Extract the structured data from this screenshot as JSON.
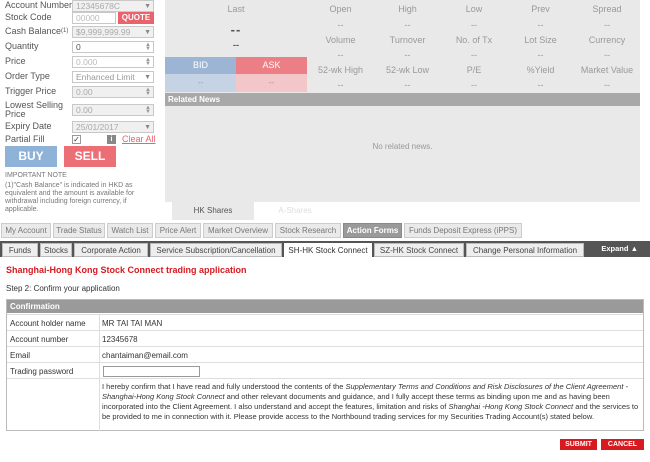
{
  "order_form": {
    "account_number_label": "Account Number",
    "account_number_value": "12345678C",
    "stock_code_label": "Stock Code",
    "stock_code_value": "00000",
    "quote_button": "QUOTE",
    "cash_balance_label": "Cash Balance",
    "cash_balance_sup": "(1)",
    "cash_balance_value": "$9,999,999.99",
    "quantity_label": "Quantity",
    "quantity_value": "0",
    "price_label": "Price",
    "price_value": "0.000",
    "order_type_label": "Order Type",
    "order_type_value": "Enhanced Limit",
    "trigger_price_label": "Trigger Price",
    "trigger_price_value": "0.00",
    "lowest_selling_label_1": "Lowest Selling",
    "lowest_selling_label_2": "Price",
    "lowest_selling_value": "0.00",
    "expiry_label": "Expiry Date",
    "expiry_value": "25/01/2017",
    "partial_fill_label": "Partial Fill",
    "partial_fill_check": "✓",
    "info_icon": "i",
    "clear_all": "Clear All",
    "buy": "BUY",
    "sell": "SELL",
    "important_note_title": "IMPORTANT NOTE",
    "important_note_text": "(1)\"Cash Balance\" is indicated in HKD as equivalent and the amount is available for withdrawal including foreign currency, if applicable."
  },
  "quote": {
    "headers_row1": [
      "Last",
      "Open",
      "High",
      "Low",
      "Prev",
      "Spread"
    ],
    "values_row1": [
      "--",
      "--",
      "--",
      "--",
      "--"
    ],
    "last_value": "--",
    "last_change": "--",
    "headers_row2": [
      "Volume",
      "Turnover",
      "No. of Tx",
      "Lot Size",
      "Currency"
    ],
    "values_row2": [
      "--",
      "--",
      "--",
      "--",
      "--"
    ],
    "headers_row3": [
      "52-wk High",
      "52-wk Low",
      "P/E",
      "%Yield",
      "Market Value"
    ],
    "values_row3": [
      "--",
      "--",
      "--",
      "--",
      "--"
    ],
    "bid_label": "BID",
    "ask_label": "ASK",
    "bid_value": "--",
    "ask_value": "--",
    "related_news": "Related News",
    "no_news": "No related news.",
    "hk_shares_tab": "HK Shares",
    "a_shares_tab": "A-Shares"
  },
  "main_nav": [
    "My Account",
    "Trade Status",
    "Watch List",
    "Price Alert",
    "Market Overview",
    "Stock Research",
    "Action Forms",
    "Funds Deposit Express (iPPS)"
  ],
  "main_nav_active": "Action Forms",
  "sub_nav": [
    "Funds",
    "Stocks",
    "Corporate Action",
    "Service Subscription/Cancellation",
    "SH-HK Stock Connect",
    "SZ-HK Stock Connect",
    "Change Personal Information"
  ],
  "sub_nav_active": "SH-HK Stock Connect",
  "expand": "Expand",
  "expand_icon": "▲",
  "application": {
    "title": "Shanghai-Hong Kong Stock Connect trading application",
    "step": "Step 2: Confirm your application",
    "confirmation_header": "Confirmation",
    "holder_label": "Account holder name",
    "holder_value": "MR TAI TAI MAN",
    "number_label": "Account number",
    "number_value": "12345678",
    "email_label": "Email",
    "email_value": "chantaiman@email.com",
    "password_label": "Trading password",
    "terms_1": "I hereby confirm that I have read and fully understood the contents of the ",
    "terms_2": "Supplementary Terms and Conditions and Risk Disclosures of the Client Agreement - Shanghai-Hong Kong Stock Connect",
    "terms_3": " and other relevant documents and guidance, and I fully accept these terms as binding upon me and as having been incorporated into the Client Agreement. I also understand and accept the features, limitation and risks of ",
    "terms_4": "Shanghai -Hong Kong Stock Connect",
    "terms_5": " and the services to be provided to me in connection with it. Please provide access to the Northbound trading services for my Securities Trading Account(s) stated below.",
    "submit": "SUBMIT",
    "cancel": "CANCEL"
  },
  "colors": {
    "accent_red": "#d71920",
    "bid_blue": "#8fb2d8",
    "ask_red": "#ec6f75"
  }
}
